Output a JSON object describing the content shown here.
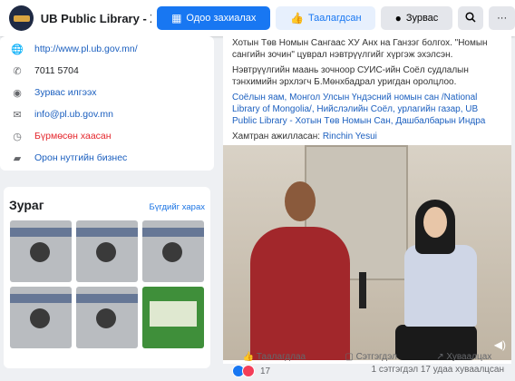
{
  "header": {
    "page_name": "UB Public Library - Хо...",
    "buttons": {
      "book": "Одоо захиалах",
      "like": "Таалагдсан",
      "message": "Зурвас",
      "search_icon": "search-icon",
      "more": "···"
    }
  },
  "about": {
    "website": "http://www.pl.ub.gov.mn/",
    "phone": "7011 5704",
    "message": "Зурвас илгээх",
    "email": "info@pl.ub.gov.mn",
    "hours": "Бүрмөсөн хаасан",
    "category": "Орон нутгийн бизнес"
  },
  "photos": {
    "title": "Зураг",
    "see_all": "Бүгдийг харах"
  },
  "post": {
    "line1": "Хотын Төв Номын Сангаас ХУ Анх на Ганзэг болгох. \"Номын сангийн зочин\" цуврал нэвтрүүлгийг хүргэж эхэлсэн.",
    "line2": "Нэвтрүүлгийн маань зочноор СУИС-ийн Соёл судлалын тэнхимийн эрхлэгч Б.Мөнхбадрал уригдан оролцлоо.",
    "tags": "Соёлын яам, Монгол Улсын Үндэсний номын сан /National Library of Mongolia/, Нийслэлийн Соёл, урлагийн газар, UB Public Library - Хотын Төв Номын Сан, Дашбалбарын Индра",
    "collab_label": "Хамтран ажилласан:",
    "collab_name": "Rinchin Yesui",
    "reaction_count": "17",
    "comments": "1 сэтгэгдэл",
    "shares": "17 удаа хуваалцсан",
    "action_like": "Таалагдлаа",
    "action_comment": "Сэтгэгдэл",
    "action_share": "Хуваалцах"
  },
  "colors": {
    "brand": "#1877f2",
    "link": "#1b5fbf",
    "red": "#e4262c"
  }
}
